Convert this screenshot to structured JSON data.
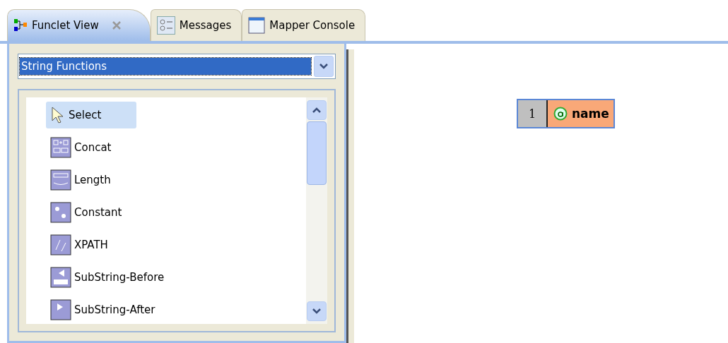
{
  "tabs": [
    {
      "label": "Funclet View",
      "kind": "funclet",
      "selected": true,
      "closable": true
    },
    {
      "label": "Messages",
      "kind": "messages",
      "selected": false,
      "closable": false
    },
    {
      "label": "Mapper Console",
      "kind": "console",
      "selected": false,
      "closable": false
    }
  ],
  "category_dropdown": {
    "value": "String Functions"
  },
  "palette": [
    {
      "label": "Select",
      "kind": "select",
      "selected": true
    },
    {
      "label": "Concat",
      "kind": "concat",
      "selected": false
    },
    {
      "label": "Length",
      "kind": "length",
      "selected": false
    },
    {
      "label": "Constant",
      "kind": "constant",
      "selected": false
    },
    {
      "label": "XPATH",
      "kind": "xpath",
      "selected": false
    },
    {
      "label": "SubString-Before",
      "kind": "before",
      "selected": false
    },
    {
      "label": "SubString-After",
      "kind": "after",
      "selected": false
    }
  ],
  "canvas": {
    "nodes": [
      {
        "index": "1",
        "label": "name"
      }
    ]
  }
}
